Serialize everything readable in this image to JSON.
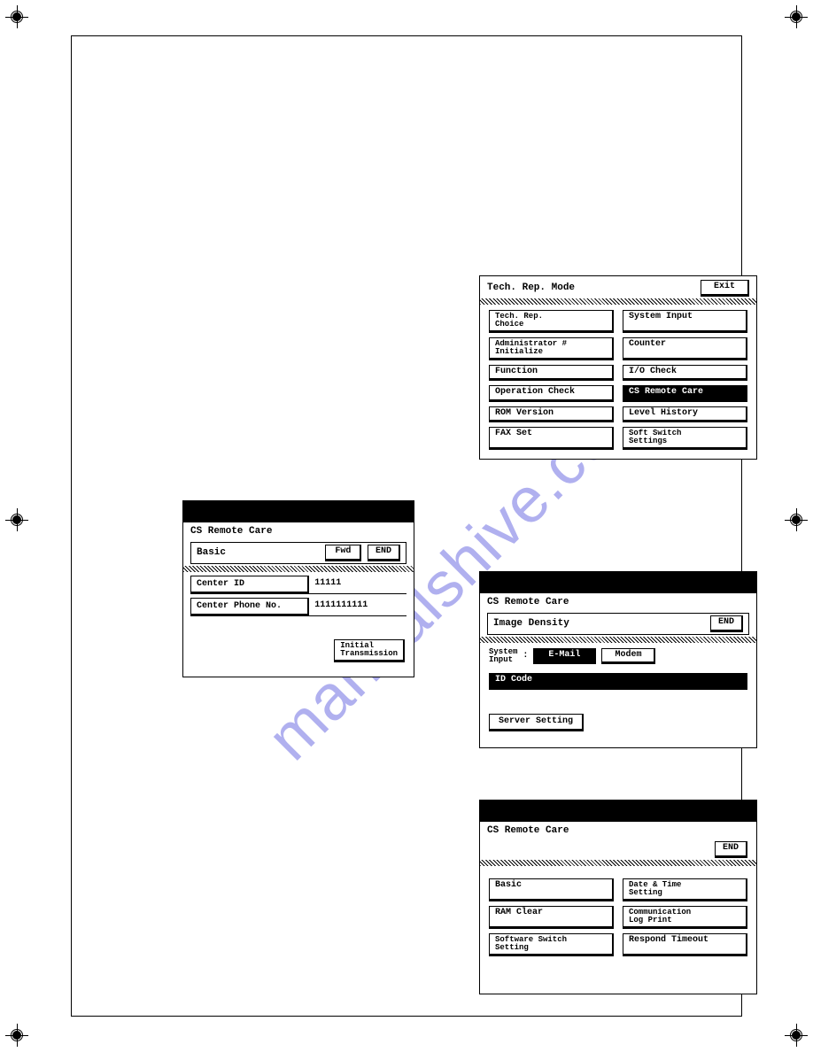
{
  "watermark": "manualshive.com",
  "panel1": {
    "title": "Tech. Rep. Mode",
    "exit": "Exit",
    "left": [
      "Tech. Rep.\nChoice",
      "Administrator #\nInitialize",
      "Function",
      "Operation Check",
      "ROM Version",
      "FAX Set"
    ],
    "right": [
      "System Input",
      "Counter",
      "I/O Check",
      "CS Remote Care",
      "Level History",
      "Soft Switch\nSettings"
    ]
  },
  "panel2": {
    "title": "CS Remote Care",
    "subheader": "Basic",
    "fwd": "Fwd",
    "end": "END",
    "center_id_label": "Center ID",
    "center_id_value": "11111",
    "center_phone_label": "Center Phone No.",
    "center_phone_value": "1111111111",
    "initial": "Initial\nTransmission"
  },
  "panel3": {
    "title": "CS Remote Care",
    "subheader": "Image Density",
    "end": "END",
    "sysinput_label": "System\nInput",
    "colon": ":",
    "email": "E-Mail",
    "modem": "Modem",
    "idcode": "ID Code",
    "server": "Server Setting"
  },
  "panel4": {
    "title": "CS Remote Care",
    "end": "END",
    "left": [
      "Basic",
      "RAM Clear",
      "Software Switch\nSetting"
    ],
    "right": [
      "Date & Time\nSetting",
      "Communication\nLog Print",
      "Respond Timeout"
    ]
  }
}
